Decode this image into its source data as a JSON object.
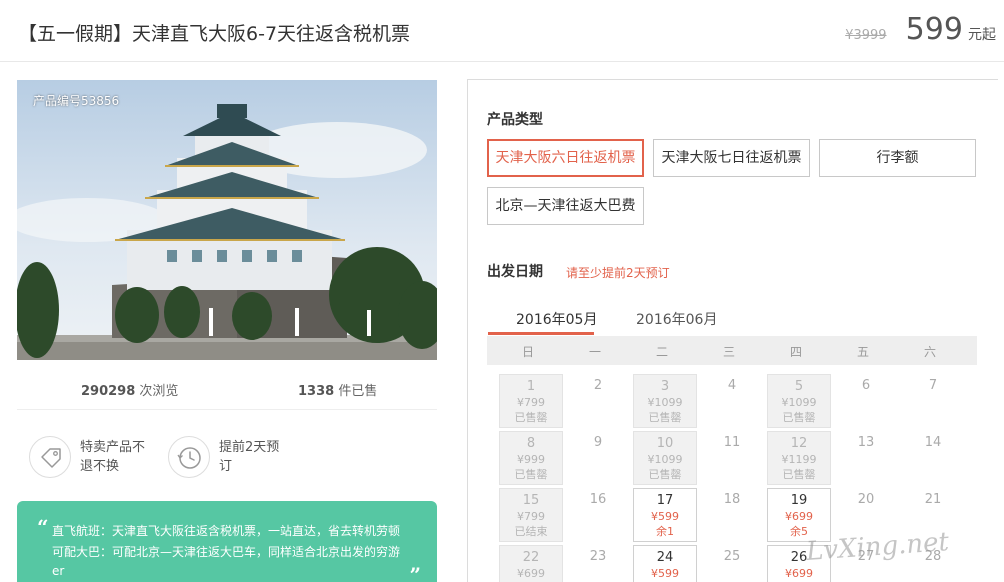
{
  "header": {
    "title": "【五一假期】天津直飞大阪6-7天往返含税机票",
    "original_price": "¥3999",
    "price": "599",
    "price_unit": "元起"
  },
  "gallery": {
    "product_no": "产品编号53856"
  },
  "stats": {
    "views_count": "290298",
    "views_label": "次浏览",
    "sold_count": "1338",
    "sold_label": "件已售"
  },
  "features": [
    {
      "icon": "tag-icon",
      "text": "特卖产品不退不换"
    },
    {
      "icon": "clock-history-icon",
      "text": "提前2天预订"
    }
  ],
  "banner": {
    "quote_open": "“",
    "quote_close": "”",
    "line1": "直飞航班：天津直飞大阪往返含税机票，一站直达，省去转机劳顿",
    "line2": "可配大巴：可配北京—天津往返大巴车，同样适合北京出发的穷游",
    "line3": "er"
  },
  "booking": {
    "type_label": "产品类型",
    "types": [
      "天津大阪六日往返机票",
      "天津大阪七日往返机票",
      "行李额",
      "北京—天津往返大巴费"
    ],
    "selected_type_index": 0,
    "date_label": "出发日期",
    "notice": "请至少提前2天预订",
    "months": [
      "2016年05月",
      "2016年06月"
    ],
    "selected_month_index": 0,
    "weekdays": [
      "日",
      "一",
      "二",
      "三",
      "四",
      "五",
      "六"
    ],
    "days": [
      {
        "day": "1",
        "price": "¥799",
        "status": "已售罄",
        "state": "soldout"
      },
      {
        "day": "2",
        "price": "",
        "status": "",
        "state": "empty"
      },
      {
        "day": "3",
        "price": "¥1099",
        "status": "已售罄",
        "state": "soldout"
      },
      {
        "day": "4",
        "price": "",
        "status": "",
        "state": "empty"
      },
      {
        "day": "5",
        "price": "¥1099",
        "status": "已售罄",
        "state": "soldout"
      },
      {
        "day": "6",
        "price": "",
        "status": "",
        "state": "empty"
      },
      {
        "day": "7",
        "price": "",
        "status": "",
        "state": "empty"
      },
      {
        "day": "8",
        "price": "¥999",
        "status": "已售罄",
        "state": "soldout"
      },
      {
        "day": "9",
        "price": "",
        "status": "",
        "state": "empty"
      },
      {
        "day": "10",
        "price": "¥1099",
        "status": "已售罄",
        "state": "soldout"
      },
      {
        "day": "11",
        "price": "",
        "status": "",
        "state": "empty"
      },
      {
        "day": "12",
        "price": "¥1199",
        "status": "已售罄",
        "state": "soldout"
      },
      {
        "day": "13",
        "price": "",
        "status": "",
        "state": "empty"
      },
      {
        "day": "14",
        "price": "",
        "status": "",
        "state": "empty"
      },
      {
        "day": "15",
        "price": "¥799",
        "status": "已结束",
        "state": "soldout"
      },
      {
        "day": "16",
        "price": "",
        "status": "",
        "state": "empty"
      },
      {
        "day": "17",
        "price": "¥599",
        "status": "余1",
        "state": "avail"
      },
      {
        "day": "18",
        "price": "",
        "status": "",
        "state": "empty"
      },
      {
        "day": "19",
        "price": "¥699",
        "status": "余5",
        "state": "avail"
      },
      {
        "day": "20",
        "price": "",
        "status": "",
        "state": "empty"
      },
      {
        "day": "21",
        "price": "",
        "status": "",
        "state": "empty"
      },
      {
        "day": "22",
        "price": "¥699",
        "status": "",
        "state": "soldout"
      },
      {
        "day": "23",
        "price": "",
        "status": "",
        "state": "empty"
      },
      {
        "day": "24",
        "price": "¥599",
        "status": "",
        "state": "avail"
      },
      {
        "day": "25",
        "price": "",
        "status": "",
        "state": "empty"
      },
      {
        "day": "26",
        "price": "¥699",
        "status": "",
        "state": "avail"
      },
      {
        "day": "27",
        "price": "",
        "status": "",
        "state": "empty"
      },
      {
        "day": "28",
        "price": "",
        "status": "",
        "state": "empty"
      }
    ]
  },
  "watermark": "LvXing.net",
  "colors": {
    "accent": "#e2624b",
    "banner_bg": "#56c7a3",
    "soldout_bg": "#f1f1f1"
  }
}
